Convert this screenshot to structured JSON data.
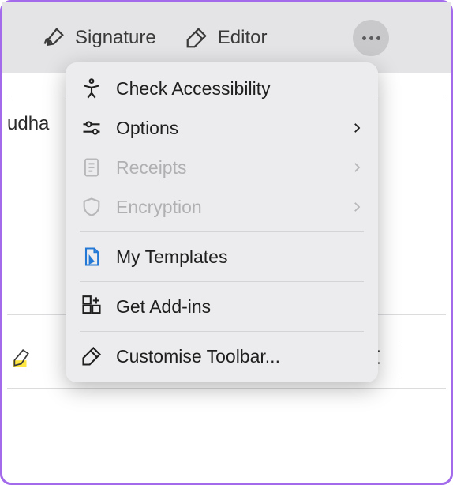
{
  "toolbar": {
    "signature_label": "Signature",
    "editor_label": "Editor"
  },
  "background": {
    "partial_text": "udha"
  },
  "menu": {
    "items": [
      {
        "label": "Check Accessibility",
        "has_chevron": false,
        "disabled": false
      },
      {
        "label": "Options",
        "has_chevron": true,
        "disabled": false
      },
      {
        "label": "Receipts",
        "has_chevron": true,
        "disabled": true
      },
      {
        "label": "Encryption",
        "has_chevron": true,
        "disabled": true
      },
      {
        "label": "My Templates",
        "has_chevron": false,
        "disabled": false
      },
      {
        "label": "Get Add-ins",
        "has_chevron": false,
        "disabled": false
      },
      {
        "label": "Customise Toolbar...",
        "has_chevron": false,
        "disabled": false
      }
    ]
  }
}
